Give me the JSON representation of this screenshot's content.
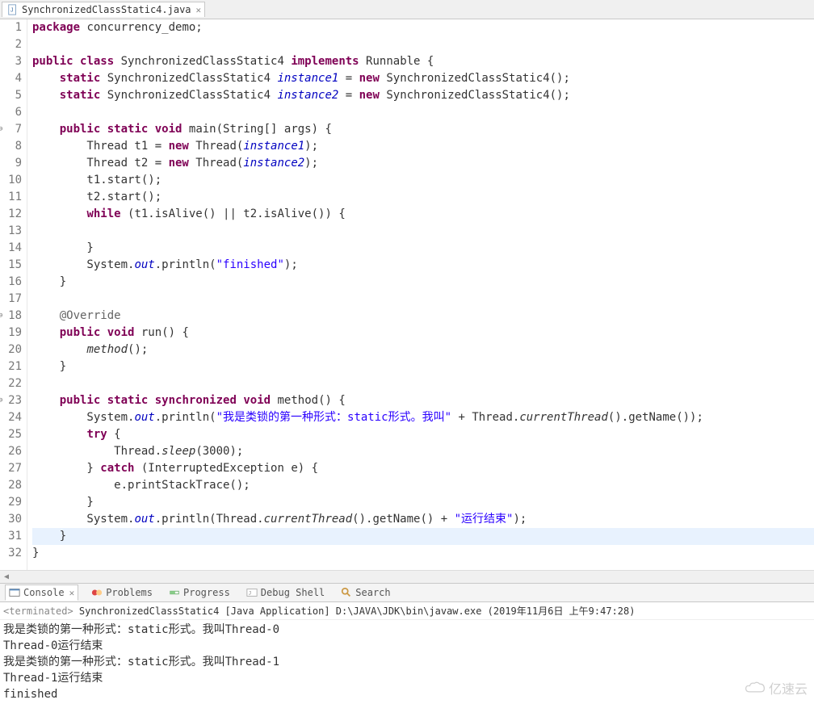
{
  "tab": {
    "filename": "SynchronizedClassStatic4.java"
  },
  "code": {
    "lines": [
      {
        "n": 1,
        "html": "<span class='kw'>package</span> concurrency_demo;"
      },
      {
        "n": 2,
        "html": ""
      },
      {
        "n": 3,
        "html": "<span class='kw'>public</span> <span class='kw'>class</span> SynchronizedClassStatic4 <span class='kw'>implements</span> Runnable {"
      },
      {
        "n": 4,
        "html": "    <span class='kw'>static</span> SynchronizedClassStatic4 <span class='fld-it'>instance1</span> = <span class='kw'>new</span> SynchronizedClassStatic4();"
      },
      {
        "n": 5,
        "html": "    <span class='kw'>static</span> SynchronizedClassStatic4 <span class='fld-it'>instance2</span> = <span class='kw'>new</span> SynchronizedClassStatic4();"
      },
      {
        "n": 6,
        "html": ""
      },
      {
        "n": 7,
        "fold": "⊖",
        "html": "    <span class='kw'>public</span> <span class='kw'>static</span> <span class='kw'>void</span> main(String[] args) {"
      },
      {
        "n": 8,
        "html": "        Thread t1 = <span class='kw'>new</span> Thread(<span class='fld-it'>instance1</span>);"
      },
      {
        "n": 9,
        "html": "        Thread t2 = <span class='kw'>new</span> Thread(<span class='fld-it'>instance2</span>);"
      },
      {
        "n": 10,
        "html": "        t1.start();"
      },
      {
        "n": 11,
        "html": "        t2.start();"
      },
      {
        "n": 12,
        "html": "        <span class='kw'>while</span> (t1.isAlive() || t2.isAlive()) {"
      },
      {
        "n": 13,
        "html": ""
      },
      {
        "n": 14,
        "html": "        }"
      },
      {
        "n": 15,
        "html": "        System.<span class='fld-it'>out</span>.println(<span class='str'>\"finished\"</span>);"
      },
      {
        "n": 16,
        "html": "    }"
      },
      {
        "n": 17,
        "html": ""
      },
      {
        "n": 18,
        "fold": "⊖",
        "html": "    <span class='ann'>@Override</span>"
      },
      {
        "n": 19,
        "warn": "△",
        "html": "    <span class='kw'>public</span> <span class='kw'>void</span> run() {"
      },
      {
        "n": 20,
        "html": "        <span class='meth-it'>method</span>();"
      },
      {
        "n": 21,
        "html": "    }"
      },
      {
        "n": 22,
        "html": ""
      },
      {
        "n": 23,
        "fold": "⊖",
        "html": "    <span class='kw'>public</span> <span class='kw'>static</span> <span class='kw'>synchronized</span> <span class='kw'>void</span> method() {"
      },
      {
        "n": 24,
        "html": "        System.<span class='fld-it'>out</span>.println(<span class='str'>\"我是类锁的第一种形式：static形式。我叫\"</span> + Thread.<span class='meth-it'>currentThread</span>().getName());"
      },
      {
        "n": 25,
        "html": "        <span class='kw'>try</span> {"
      },
      {
        "n": 26,
        "html": "            Thread.<span class='meth-it'>sleep</span>(3000);"
      },
      {
        "n": 27,
        "html": "        } <span class='kw'>catch</span> (InterruptedException e) {"
      },
      {
        "n": 28,
        "html": "            e.printStackTrace();"
      },
      {
        "n": 29,
        "html": "        }"
      },
      {
        "n": 30,
        "html": "        System.<span class='fld-it'>out</span>.println(Thread.<span class='meth-it'>currentThread</span>().getName() + <span class='str'>\"运行结束\"</span>);"
      },
      {
        "n": 31,
        "current": true,
        "html": "    }"
      },
      {
        "n": 32,
        "html": "}"
      }
    ]
  },
  "bottomTabs": {
    "console": "Console",
    "problems": "Problems",
    "progress": "Progress",
    "debugShell": "Debug Shell",
    "search": "Search"
  },
  "consoleHeader": {
    "terminated": "<terminated>",
    "rest": " SynchronizedClassStatic4 [Java Application] D:\\JAVA\\JDK\\bin\\javaw.exe (2019年11月6日 上午9:47:28)"
  },
  "consoleOutput": [
    "我是类锁的第一种形式：static形式。我叫Thread-0",
    "Thread-0运行结束",
    "我是类锁的第一种形式：static形式。我叫Thread-1",
    "Thread-1运行结束",
    "finished"
  ],
  "watermark": "亿速云"
}
